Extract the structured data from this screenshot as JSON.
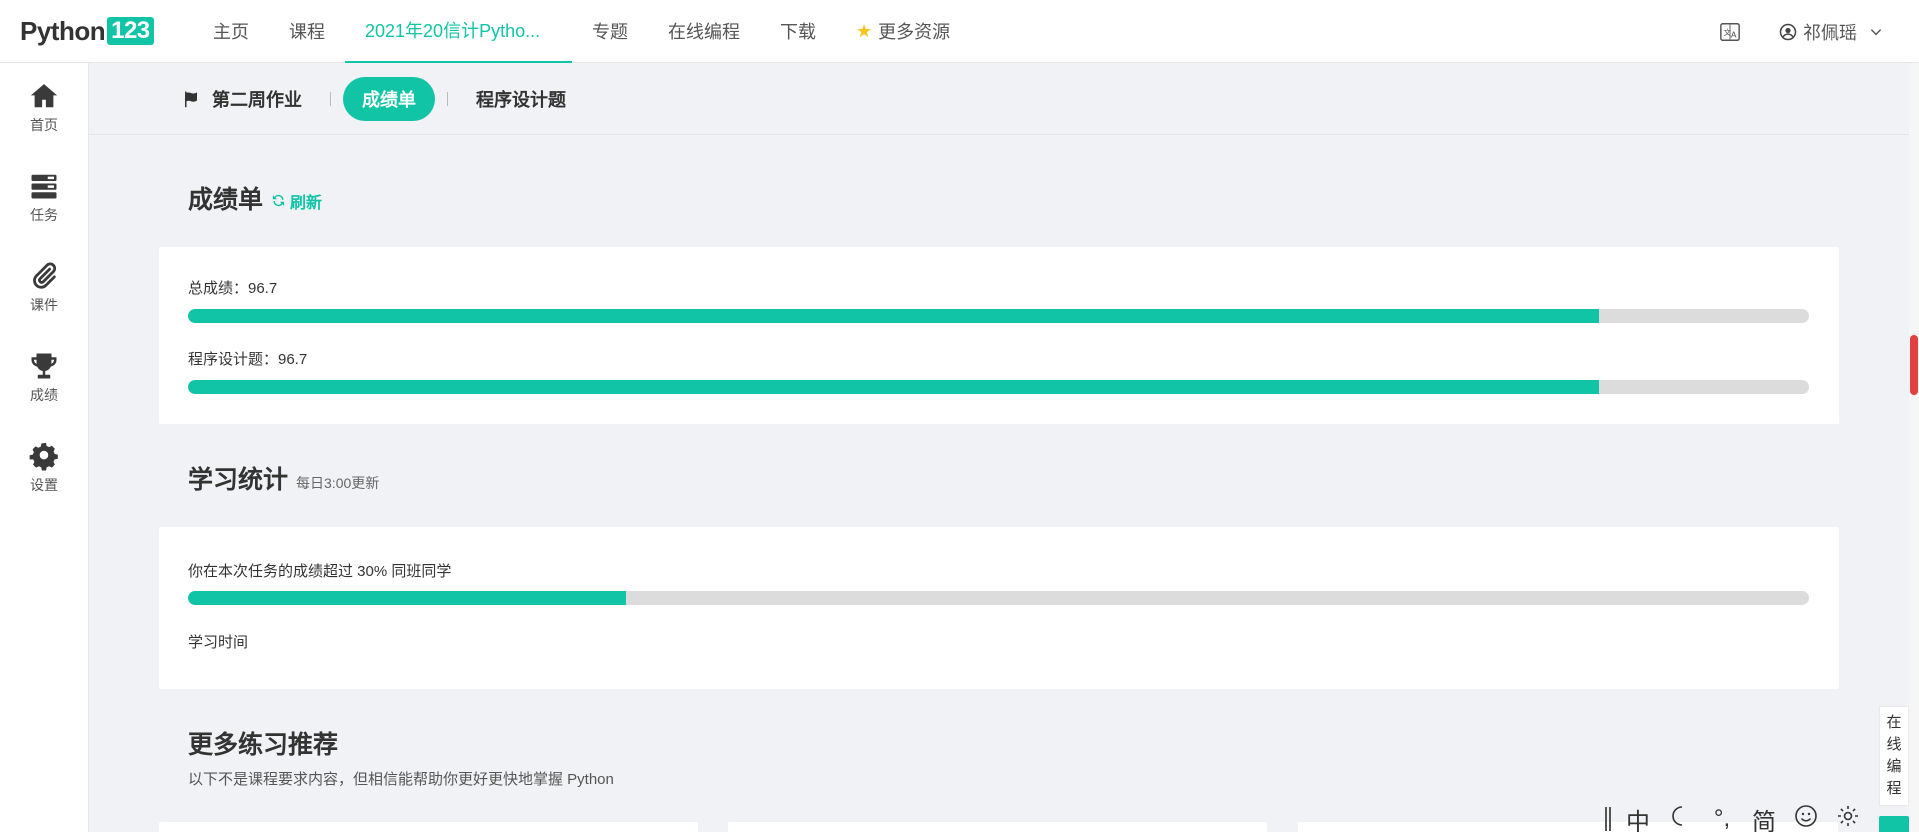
{
  "topnav": {
    "logo_text": "Python",
    "logo_badge": "123",
    "items": [
      {
        "label": "主页"
      },
      {
        "label": "课程"
      },
      {
        "label": "2021年20信计Pytho..."
      },
      {
        "label": "专题"
      },
      {
        "label": "在线编程"
      },
      {
        "label": "下载"
      },
      {
        "label": "更多资源"
      }
    ],
    "active_index": 2,
    "user_name": "祁佩瑶"
  },
  "sidebar": {
    "items": [
      {
        "label": "首页",
        "icon": "home-icon"
      },
      {
        "label": "任务",
        "icon": "tasks-icon"
      },
      {
        "label": "课件",
        "icon": "paperclip-icon"
      },
      {
        "label": "成绩",
        "icon": "trophy-icon"
      },
      {
        "label": "设置",
        "icon": "gear-icon"
      }
    ]
  },
  "subtabs": {
    "homework": "第二周作业",
    "report": "成绩单",
    "design": "程序设计题"
  },
  "report": {
    "title": "成绩单",
    "refresh_label": "刷新",
    "total_label": "总成绩：96.7",
    "total_value": 96.7,
    "design_label": "程序设计题：96.7",
    "design_value": 96.7
  },
  "stats": {
    "title": "学习统计",
    "update_note": "每日3:00更新",
    "rank_label": "你在本次任务的成绩超过 30% 同班同学",
    "rank_percent": 30,
    "study_time_label": "学习时间"
  },
  "more": {
    "title": "更多练习推荐",
    "description": "以下不是课程要求内容，但相信能帮助你更好更快地掌握 Python"
  },
  "float_code": {
    "chars": [
      "在",
      "线",
      "编",
      "程"
    ]
  },
  "ime": {
    "lang": "中",
    "punct": "°,",
    "script": "简"
  },
  "colors": {
    "accent": "#11c4a6",
    "track": "#dcdcdc",
    "star": "#f7c41b"
  }
}
